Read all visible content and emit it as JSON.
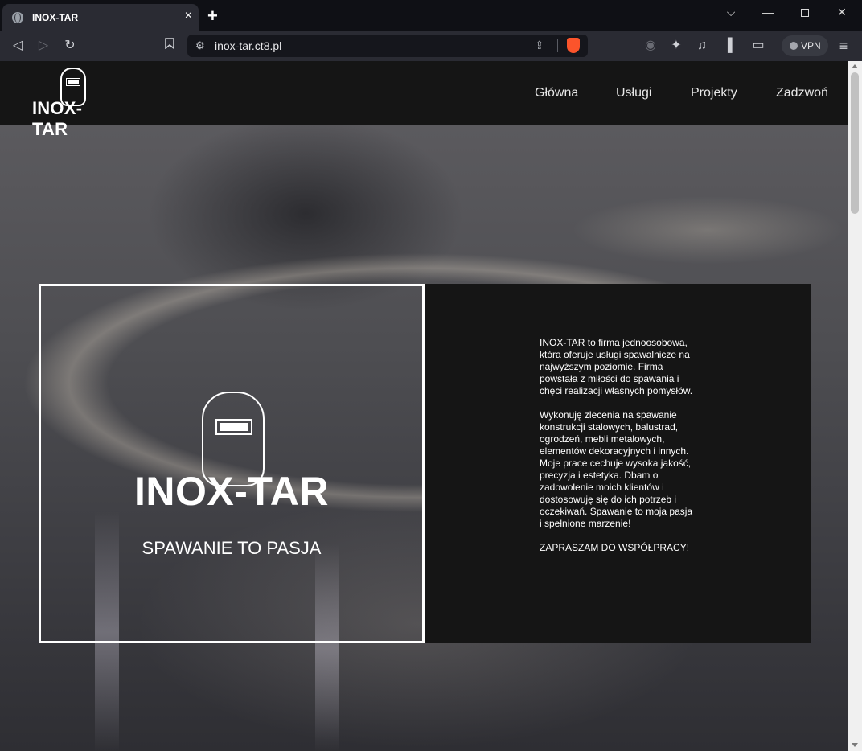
{
  "browser": {
    "tab_title": "INOX-TAR",
    "tab_close": "×",
    "new_tab": "+",
    "url": "inox-tar.ct8.pl",
    "vpn_label": "VPN",
    "window_controls": {
      "dropdown": "⌵",
      "minimize": "—",
      "close": "✕"
    },
    "toolbar_icons": {
      "back": "◁",
      "forward": "▷",
      "reload": "↻",
      "bookmark": "🔖",
      "site_settings": "⚙",
      "share": "⇪",
      "rewards": "◉",
      "extensions": "✦",
      "media": "♫",
      "sidebar": "▐",
      "wallet": "▭",
      "menu": "≡"
    }
  },
  "site": {
    "logo_text": "INOX-TAR",
    "nav": [
      "Główna",
      "Usługi",
      "Projekty",
      "Zadzwoń"
    ],
    "hero": {
      "title": "INOX-TAR",
      "tagline": "SPAWANIE TO PASJA"
    },
    "about": {
      "paragraph1": "INOX-TAR to firma jednoosobowa, która oferuje usługi spawalnicze na najwyższym poziomie. Firma powstała z miłości do spawania i chęci realizacji własnych pomysłów.",
      "paragraph2": "Wykonuję zlecenia na spawanie konstrukcji stalowych, balustrad, ogrodzeń, mebli metalowych, elementów dekoracyjnych i innych. Moje prace cechuje wysoka jakość, precyzja i estetyka. Dbam o zadowolenie moich klientów i dostosowuję się do ich potrzeb i oczekiwań. Spawanie to moja pasja i spełnione marzenie!",
      "cta": "ZAPRASZAM DO WSPÓŁPRACY!"
    }
  },
  "colors": {
    "nav_bg": "#151515",
    "panel_bg": "#151515",
    "text": "#ffffff",
    "brave_orange": "#fb542b"
  }
}
